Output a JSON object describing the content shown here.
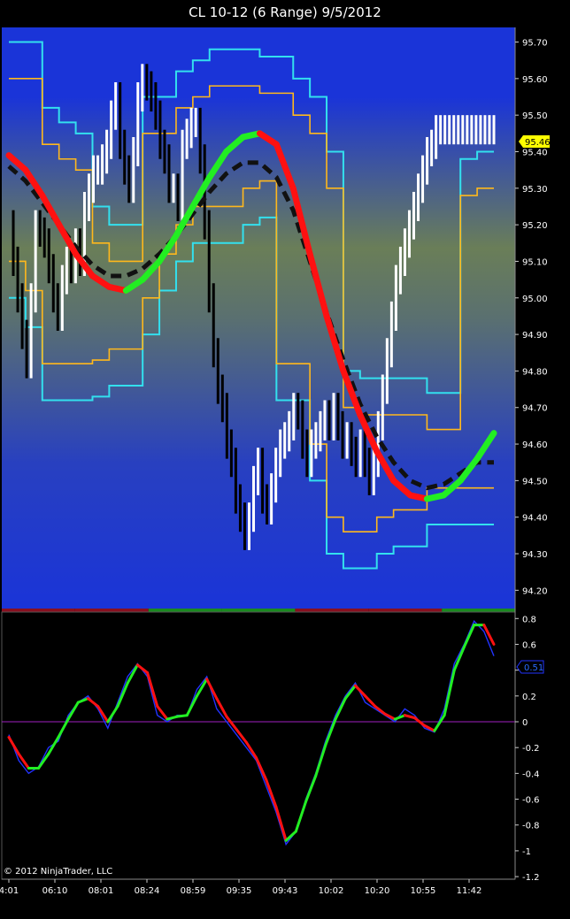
{
  "window": {
    "title": "CL 10-12 (6 Range)  9/5/2012",
    "copyright": "© 2012 NinjaTrader, LLC"
  },
  "colors": {
    "background": "#000000",
    "price_panel_top": "#1a34d8",
    "price_panel_mid": "#6a7e58",
    "price_panel_bottom": "#1a34d8",
    "bars_up": "#ffffff",
    "bars_down": "#000000",
    "envelope_outer": "#33e0ee",
    "envelope_inner": "#ffb81c",
    "ma_rising": "#22ee22",
    "ma_falling": "#ff1111",
    "ma_slow": "#111111",
    "osc_zero_line": "#a020c0",
    "osc_fast": "#2233ff",
    "last_price_badge": "#ffff00",
    "osc_badge": "#2233ff"
  },
  "chart_data": [
    {
      "type": "line",
      "panel": "price",
      "title": "CL 10-12 (6 Range)  9/5/2012",
      "ylim": [
        94.15,
        95.74
      ],
      "y_ticks": [
        94.2,
        94.3,
        94.4,
        94.5,
        94.6,
        94.7,
        94.8,
        94.9,
        95.0,
        95.1,
        95.2,
        95.3,
        95.4,
        95.5,
        95.6,
        95.7
      ],
      "y_tick_labels": [
        "94.20",
        "94.30",
        "94.40",
        "94.50",
        "94.60",
        "94.70",
        "94.80",
        "94.90",
        "95.00",
        "95.10",
        "95.20",
        "95.30",
        "95.40",
        "95.50",
        "95.60",
        "95.70"
      ],
      "x_tick_labels": [
        "4:01",
        "06:10",
        "08:01",
        "08:24",
        "08:59",
        "09:35",
        "09:43",
        "10:02",
        "10:20",
        "10:55",
        "11:42"
      ],
      "last_price_label": "95.46",
      "bar_count": 110,
      "series": [
        {
          "name": "",
          "role": "close",
          "values": [
            95.2,
            95.1,
            95.0,
            94.9,
            94.82,
            95.0,
            95.2,
            95.18,
            95.15,
            95.08,
            95.0,
            94.95,
            95.05,
            95.1,
            95.08,
            95.15,
            95.1,
            95.25,
            95.3,
            95.35,
            95.35,
            95.38,
            95.42,
            95.5,
            95.55,
            95.42,
            95.35,
            95.3,
            95.4,
            95.55,
            95.6,
            95.58,
            95.55,
            95.5,
            95.42,
            95.38,
            95.3,
            95.3,
            95.25,
            95.42,
            95.45,
            95.48,
            95.48,
            95.38,
            95.2,
            95.0,
            94.85,
            94.75,
            94.7,
            94.6,
            94.55,
            94.45,
            94.4,
            94.35,
            94.4,
            94.5,
            94.55,
            94.45,
            94.42,
            94.48,
            94.55,
            94.6,
            94.62,
            94.65,
            94.7,
            94.68,
            94.6,
            94.55,
            94.6,
            94.62,
            94.65,
            94.68,
            94.65,
            94.7,
            94.65,
            94.6,
            94.62,
            94.58,
            94.55,
            94.6,
            94.55,
            94.5,
            94.55,
            94.65,
            94.75,
            94.85,
            94.95,
            95.05,
            95.1,
            95.15,
            95.2,
            95.25,
            95.3,
            95.35,
            95.4,
            95.42,
            95.46,
            95.46,
            95.46,
            95.46,
            95.46,
            95.46,
            95.46,
            95.46,
            95.46,
            95.46,
            95.46,
            95.46,
            95.46,
            95.46
          ]
        },
        {
          "name": "",
          "role": "fast_ma",
          "values": [
            95.39,
            95.35,
            95.28,
            95.2,
            95.12,
            95.06,
            95.03,
            95.02,
            95.05,
            95.1,
            95.17,
            95.25,
            95.33,
            95.4,
            95.44,
            95.45,
            95.42,
            95.3,
            95.12,
            94.95,
            94.8,
            94.68,
            94.58,
            94.5,
            94.46,
            94.45,
            94.46,
            94.5,
            94.56,
            94.63
          ]
        },
        {
          "name": "",
          "role": "slow_ma",
          "values": [
            95.36,
            95.32,
            95.26,
            95.2,
            95.14,
            95.09,
            95.06,
            95.06,
            95.08,
            95.12,
            95.17,
            95.23,
            95.29,
            95.34,
            95.37,
            95.37,
            95.33,
            95.24,
            95.1,
            94.96,
            94.83,
            94.71,
            94.62,
            94.55,
            94.5,
            94.48,
            94.49,
            94.52,
            94.55,
            94.55
          ]
        },
        {
          "name": "",
          "role": "outer_upper",
          "values": [
            95.7,
            95.7,
            95.52,
            95.48,
            95.45,
            95.25,
            95.2,
            95.2,
            95.55,
            95.55,
            95.62,
            95.65,
            95.68,
            95.68,
            95.68,
            95.66,
            95.66,
            95.6,
            95.55,
            95.4,
            94.8,
            94.78,
            94.78,
            94.78,
            94.78,
            94.74,
            94.74,
            95.38,
            95.4,
            95.4
          ]
        },
        {
          "name": "",
          "role": "outer_lower",
          "values": [
            95.0,
            94.92,
            94.72,
            94.72,
            94.72,
            94.73,
            94.76,
            94.76,
            94.9,
            95.02,
            95.1,
            95.15,
            95.15,
            95.15,
            95.2,
            95.22,
            94.72,
            94.72,
            94.5,
            94.3,
            94.26,
            94.26,
            94.3,
            94.32,
            94.32,
            94.38,
            94.38,
            94.38,
            94.38,
            94.38
          ]
        }
      ]
    },
    {
      "type": "line",
      "panel": "oscillator",
      "ylim": [
        -1.22,
        0.85
      ],
      "y_ticks": [
        -1.2,
        -1.0,
        -0.8,
        -0.6,
        -0.4,
        -0.2,
        0.0,
        0.2,
        0.4,
        0.6,
        0.8
      ],
      "y_tick_labels": [
        "-1.2",
        "-1",
        "-0.8",
        "-0.6",
        "-0.4",
        "-0.2",
        "0",
        "0.2",
        "0.4",
        "0.6",
        "0.8"
      ],
      "last_value_label": "0.51",
      "series": [
        {
          "name": "",
          "role": "fast",
          "values": [
            -0.1,
            -0.3,
            -0.4,
            -0.35,
            -0.2,
            -0.15,
            0.05,
            0.15,
            0.2,
            0.1,
            -0.05,
            0.15,
            0.35,
            0.45,
            0.35,
            0.05,
            0.0,
            0.05,
            0.05,
            0.25,
            0.35,
            0.1,
            0.0,
            -0.1,
            -0.2,
            -0.3,
            -0.5,
            -0.7,
            -0.95,
            -0.85,
            -0.6,
            -0.4,
            -0.15,
            0.05,
            0.2,
            0.3,
            0.15,
            0.1,
            0.05,
            0.0,
            0.1,
            0.05,
            -0.05,
            -0.08,
            0.1,
            0.45,
            0.6,
            0.78,
            0.7,
            0.51
          ]
        },
        {
          "name": "",
          "role": "smoothed",
          "values": [
            -0.12,
            -0.25,
            -0.36,
            -0.36,
            -0.25,
            -0.12,
            0.02,
            0.15,
            0.18,
            0.12,
            0.0,
            0.12,
            0.3,
            0.44,
            0.38,
            0.12,
            0.02,
            0.04,
            0.05,
            0.2,
            0.33,
            0.18,
            0.04,
            -0.06,
            -0.16,
            -0.28,
            -0.45,
            -0.66,
            -0.92,
            -0.85,
            -0.62,
            -0.42,
            -0.18,
            0.02,
            0.18,
            0.28,
            0.2,
            0.12,
            0.06,
            0.02,
            0.05,
            0.03,
            -0.03,
            -0.07,
            0.05,
            0.4,
            0.58,
            0.75,
            0.75,
            0.6
          ]
        },
        {
          "name": "",
          "role": "zero_line",
          "values": [
            0.0
          ]
        }
      ]
    }
  ]
}
